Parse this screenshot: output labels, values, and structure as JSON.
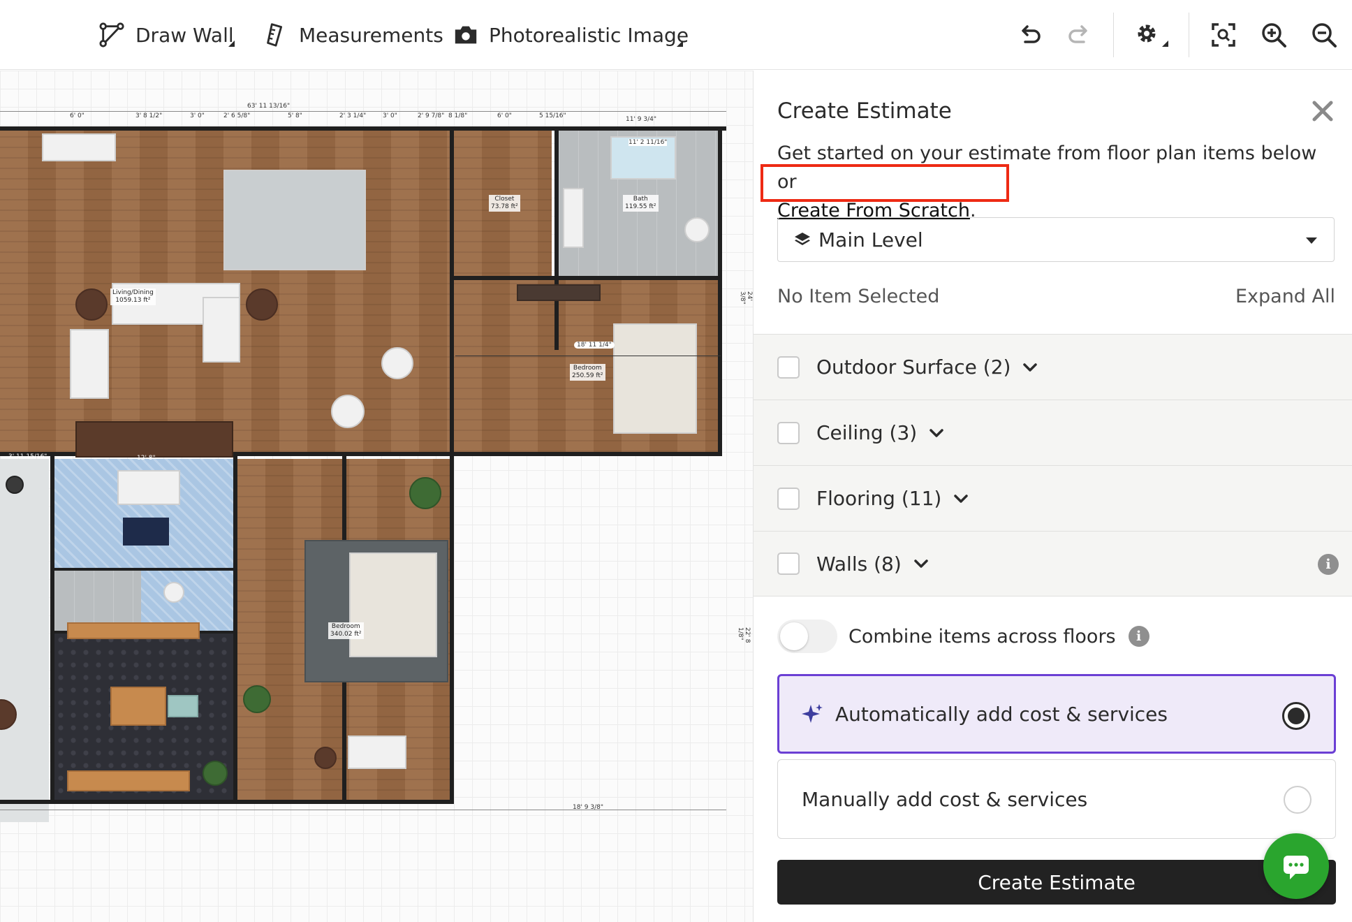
{
  "toolbar": {
    "draw_wall": "Draw Wall",
    "measurements": "Measurements",
    "photorealistic": "Photorealistic Image"
  },
  "floorplan": {
    "rooms": {
      "living": {
        "name": "Living/Dining",
        "area": "1059.13 ft²"
      },
      "closet": {
        "name": "Closet",
        "area": "73.78 ft²"
      },
      "bath": {
        "name": "Bath",
        "area": "119.55 ft²"
      },
      "bedroom1": {
        "name": "Bedroom",
        "area": "250.59 ft²"
      },
      "bedroom2": {
        "name": "Bedroom",
        "area": "340.02 ft²"
      }
    },
    "dims": {
      "top_total": "63' 11 13/16\"",
      "top_a": "6' 0\"",
      "top_b": "3' 8 1/2\"",
      "top_c": "3' 0\"",
      "top_d": "2' 6 5/8\"",
      "top_e": "5' 8\"",
      "top_f": "2' 3 1/4\"",
      "top_g": "3' 0\"",
      "top_h": "2' 9 7/8\"",
      "top_i": "8 1/8\"",
      "top_j": "6' 0\"",
      "top_k": "5 15/16\"",
      "top_l": "11' 9 3/4\"",
      "bath_width": "11' 2 11/16\"",
      "bedroom_width": "18' 11 1/4\"",
      "bottom_total": "18' 9 3/8\"",
      "right_a": "24' 3/8\"",
      "right_b": "22' 8 1/8\"",
      "stair": "12' 8\"",
      "left_a": "3' 11 15/16\""
    }
  },
  "panel": {
    "title": "Create Estimate",
    "intro": "Get started on your estimate from floor plan items below or",
    "scratch_link": "Create From Scratch",
    "intro_end": ".",
    "level": "Main Level",
    "no_item": "No Item Selected",
    "expand_all": "Expand All",
    "categories": [
      {
        "label": "Outdoor Surface (2)"
      },
      {
        "label": "Ceiling (3)"
      },
      {
        "label": "Flooring (11)"
      },
      {
        "label": "Walls (8)"
      }
    ],
    "combine_label": "Combine items across floors",
    "combine_on": false,
    "auto_label": "Automatically add cost & services",
    "manual_label": "Manually add cost & services",
    "selected_option": "auto",
    "create_button": "Create Estimate"
  },
  "colors": {
    "accent_purple": "#6b3fd4",
    "highlight_red": "#ee2a14",
    "chat_green": "#2aa52e",
    "button_dark": "#222222"
  }
}
